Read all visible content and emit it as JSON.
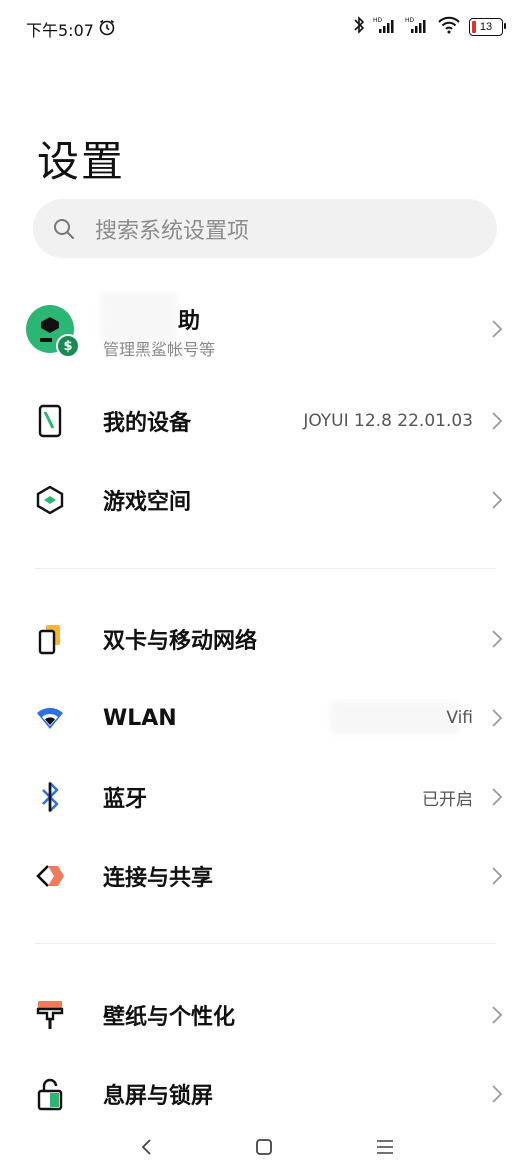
{
  "status_bar": {
    "time": "下午5:07",
    "battery_level": "13",
    "icons": [
      "alarm-icon",
      "bluetooth-icon",
      "signal-hd-icon",
      "signal-hd-icon",
      "wifi-icon",
      "battery-icon"
    ]
  },
  "header": {
    "title": "设置"
  },
  "search": {
    "placeholder": "搜索系统设置项"
  },
  "account": {
    "title": "助",
    "subtitle": "管理黑鲨帐号等"
  },
  "groups": [
    {
      "items": [
        {
          "label": "我的设备",
          "value": "JOYUI 12.8 22.01.03",
          "icon": "device-icon"
        },
        {
          "label": "游戏空间",
          "value": "",
          "icon": "game-space-icon"
        }
      ]
    },
    {
      "items": [
        {
          "label": "双卡与移动网络",
          "value": "",
          "icon": "sim-card-icon"
        },
        {
          "label": "WLAN",
          "value": "Vifi",
          "icon": "wlan-icon"
        },
        {
          "label": "蓝牙",
          "value": "已开启",
          "icon": "bluetooth-icon"
        },
        {
          "label": "连接与共享",
          "value": "",
          "icon": "connection-share-icon"
        }
      ]
    },
    {
      "items": [
        {
          "label": "壁纸与个性化",
          "value": "",
          "icon": "wallpaper-icon"
        },
        {
          "label": "息屏与锁屏",
          "value": "",
          "icon": "lock-screen-icon"
        }
      ]
    }
  ],
  "nav_bar": {
    "icons": [
      "back-icon",
      "home-icon",
      "menu-icon"
    ]
  },
  "colors": {
    "accent_green": "#2bb673",
    "battery_low": "#e03030"
  }
}
